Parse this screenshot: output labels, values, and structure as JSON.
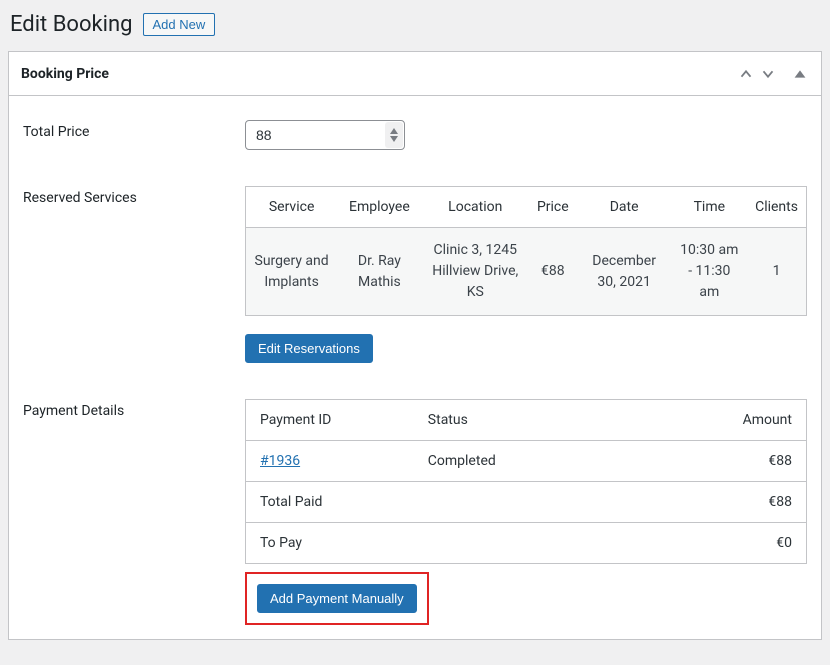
{
  "header": {
    "title": "Edit Booking",
    "add_new_label": "Add New"
  },
  "booking_price": {
    "panel_title": "Booking Price",
    "total_price_label": "Total Price",
    "total_price_value": "88",
    "reserved_services_label": "Reserved Services",
    "edit_reservations_label": "Edit Reservations",
    "services_table": {
      "headers": {
        "service": "Service",
        "employee": "Employee",
        "location": "Location",
        "price": "Price",
        "date": "Date",
        "time": "Time",
        "clients": "Clients"
      },
      "row": {
        "service": "Surgery and Implants",
        "employee": "Dr. Ray Mathis",
        "location": "Clinic 3, 1245 Hillview Drive, KS",
        "price": "€88",
        "date": "December 30, 2021",
        "time": "10:30 am - 11:30 am",
        "clients": "1"
      }
    }
  },
  "payment": {
    "label": "Payment Details",
    "headers": {
      "payment_id": "Payment ID",
      "status": "Status",
      "amount": "Amount"
    },
    "row": {
      "payment_id": "#1936",
      "status": "Completed",
      "amount": "€88"
    },
    "total_paid_label": "Total Paid",
    "total_paid_value": "€88",
    "to_pay_label": "To Pay",
    "to_pay_value": "€0",
    "add_payment_label": "Add Payment Manually"
  }
}
